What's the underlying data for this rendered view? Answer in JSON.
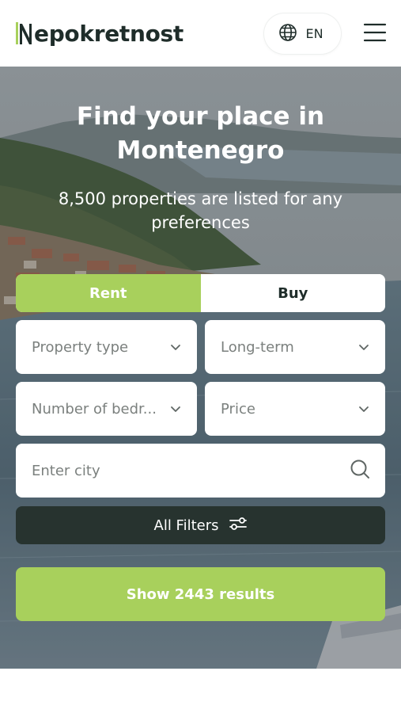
{
  "header": {
    "brand_rest": "epokretnost",
    "language": "EN"
  },
  "hero": {
    "title_line1": "Find your place in",
    "title_line2": "Montenegro",
    "subtitle": "8,500 properties are listed for any preferences"
  },
  "search": {
    "tabs": {
      "active": "Rent",
      "rent_label": "Rent",
      "buy_label": "Buy"
    },
    "property_type": "Property type",
    "term": "Long-term",
    "bedrooms": "Number of bedr...",
    "price": "Price",
    "city_placeholder": "Enter city",
    "filters_label": "All Filters",
    "show_results_label": "Show 2443 results"
  },
  "colors": {
    "accent_green": "#a8d05c",
    "dark_button": "#27332f",
    "text_dark": "#1f2d2a",
    "placeholder_gray": "#7b807e"
  },
  "icons": [
    "globe-icon",
    "hamburger-menu-icon",
    "chevron-down-icon",
    "search-icon",
    "filter-sliders-icon"
  ]
}
